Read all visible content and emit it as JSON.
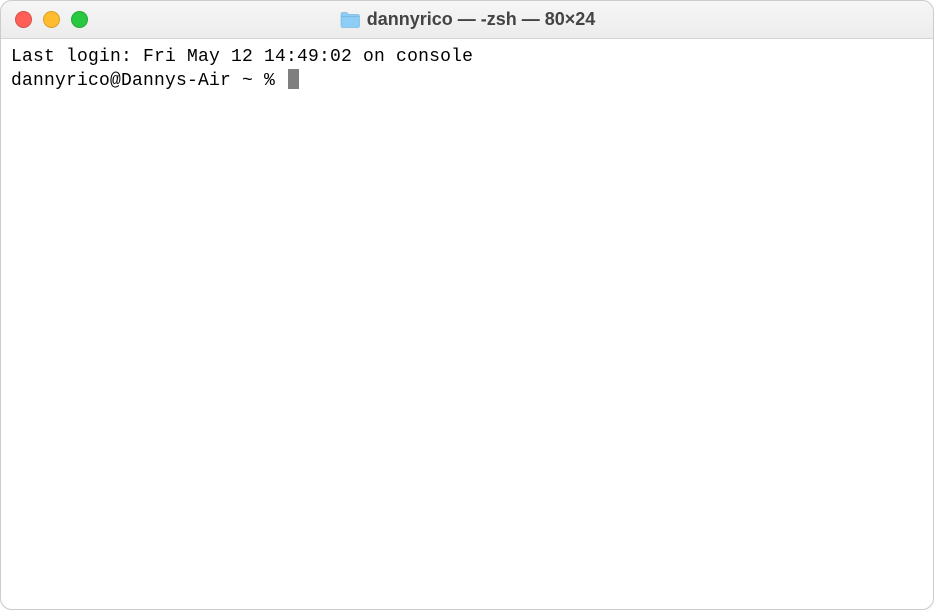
{
  "titlebar": {
    "icon": "folder-icon",
    "title": "dannyrico — -zsh — 80×24"
  },
  "terminal": {
    "last_login_line": "Last login: Fri May 12 14:49:02 on console",
    "prompt": "dannyrico@Dannys-Air ~ % "
  }
}
